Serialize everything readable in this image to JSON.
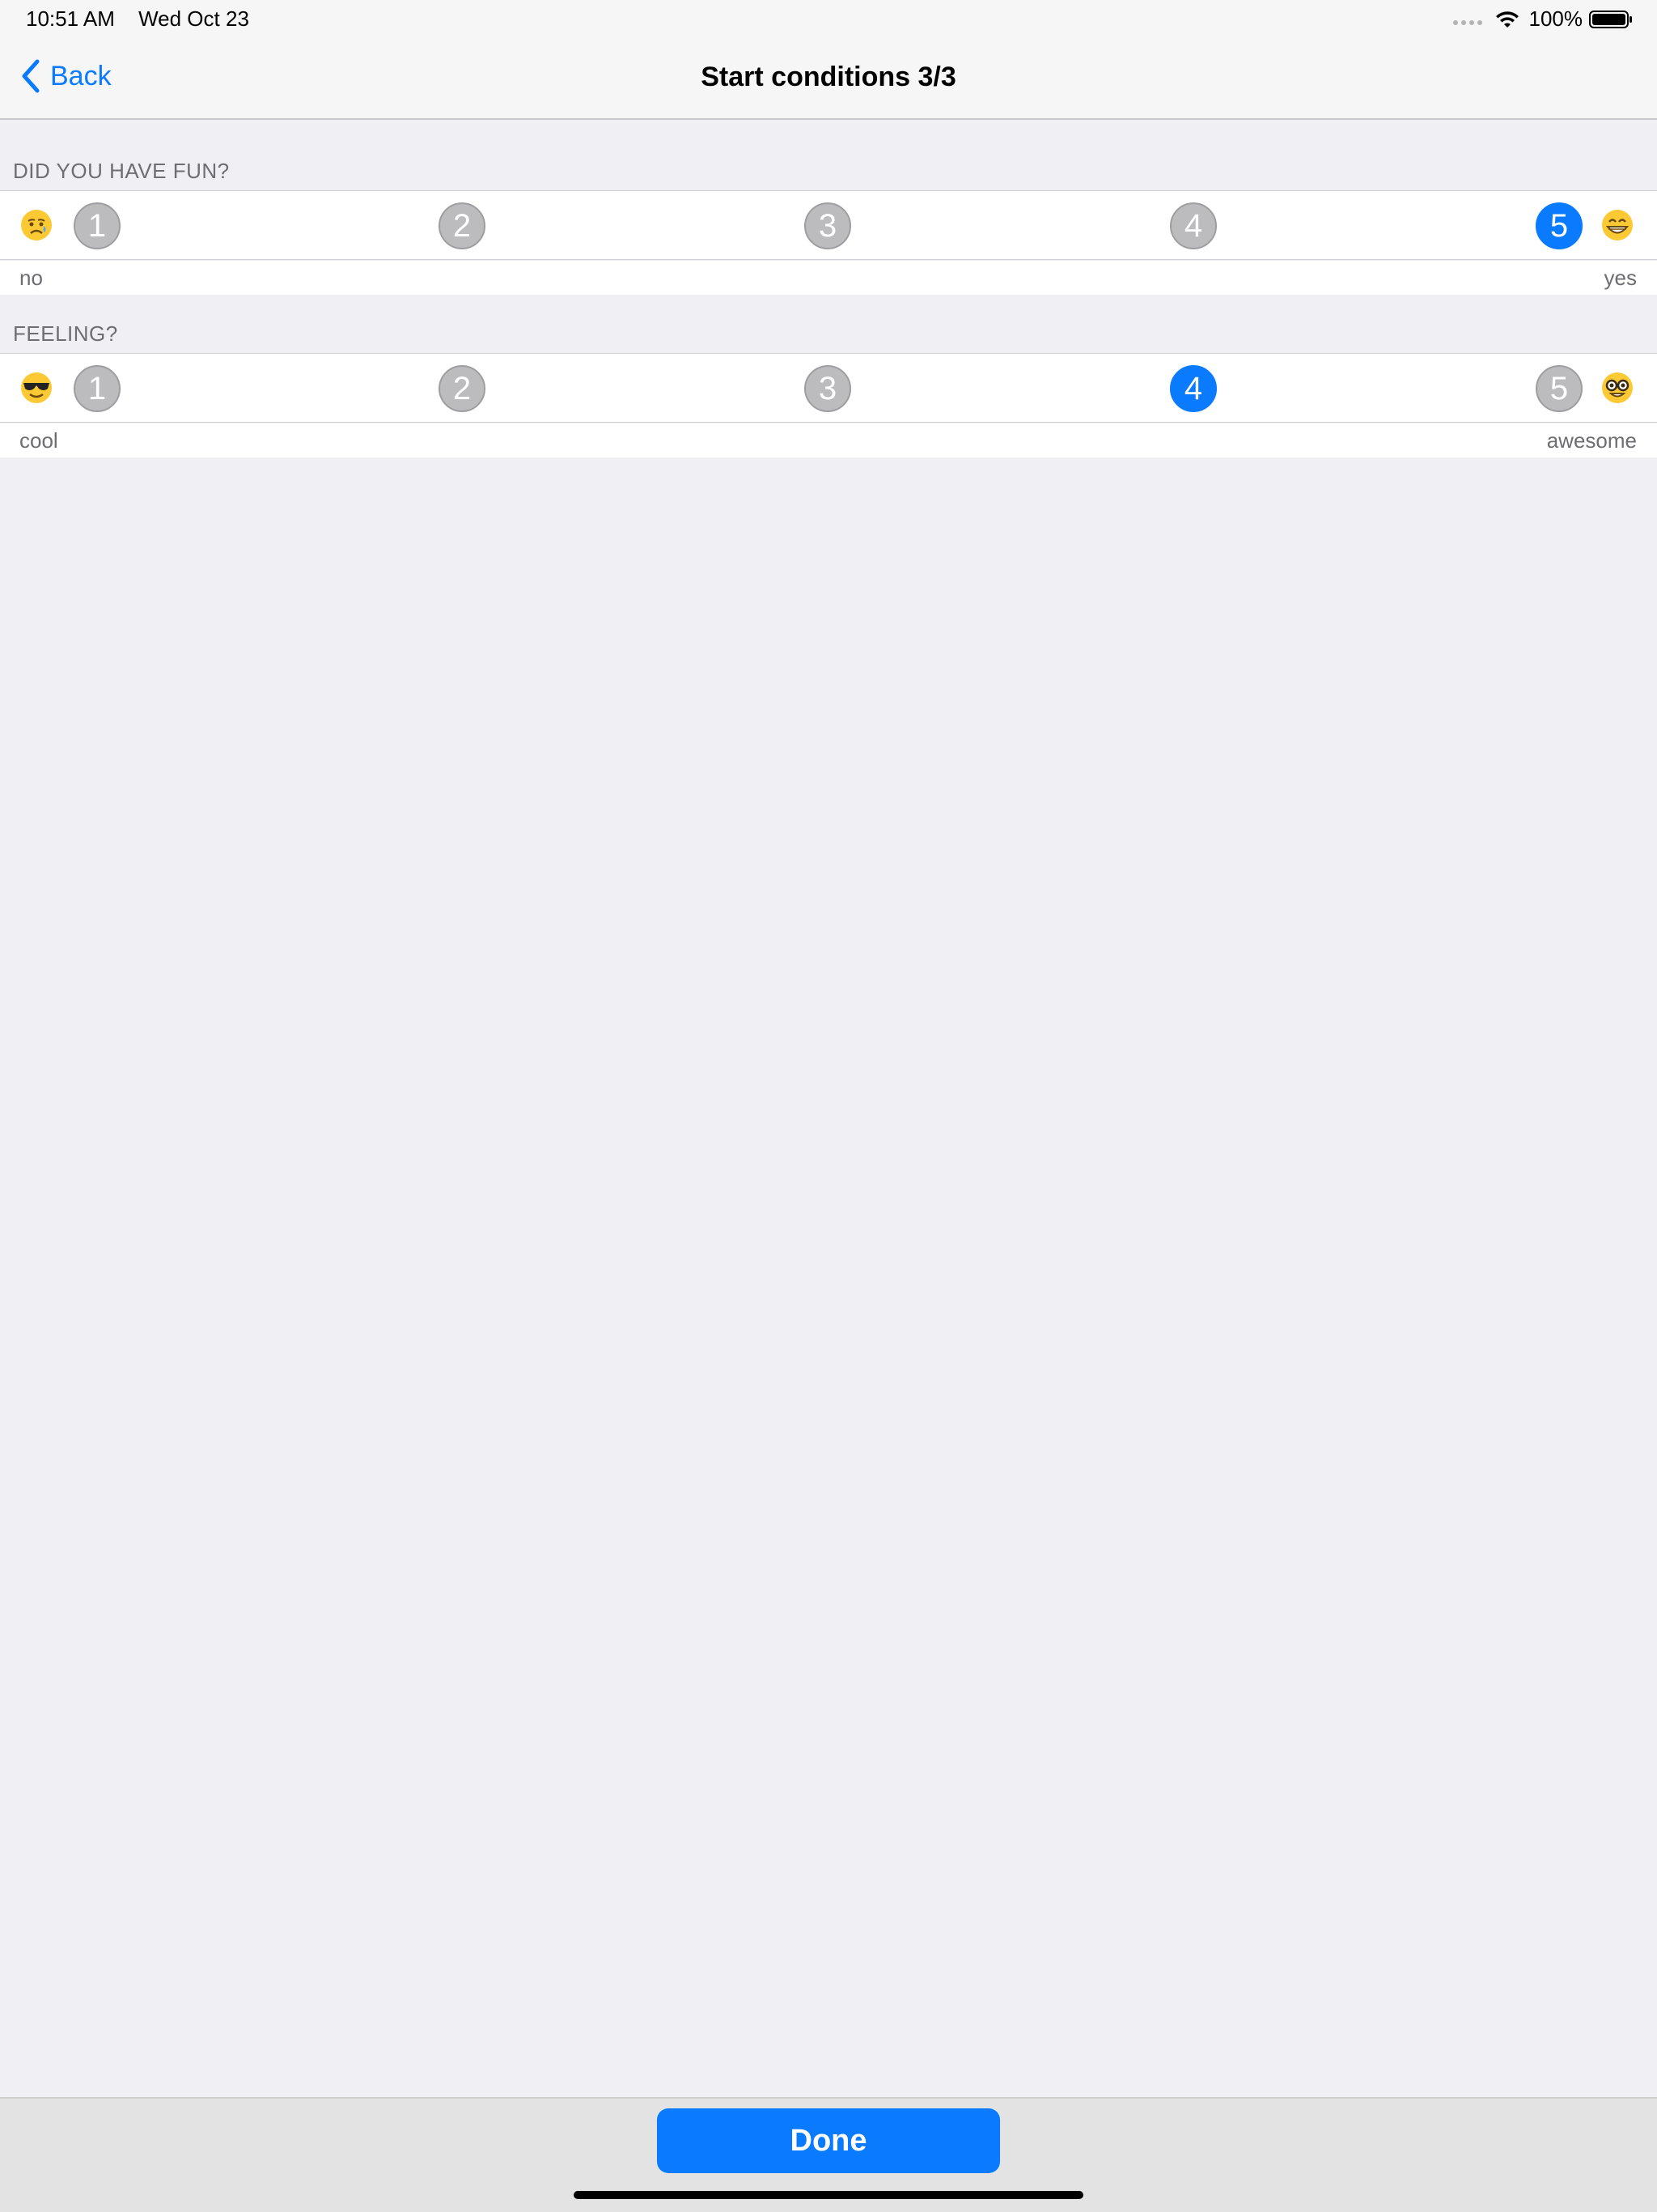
{
  "status_bar": {
    "time": "10:51 AM",
    "date": "Wed Oct 23",
    "battery": "100%",
    "icons": [
      "signal-dots-icon",
      "wifi-icon",
      "battery-icon"
    ]
  },
  "nav": {
    "back_label": "Back",
    "title": "Start conditions 3/3"
  },
  "questions": [
    {
      "header": "DID YOU HAVE FUN?",
      "options": [
        "1",
        "2",
        "3",
        "4",
        "5"
      ],
      "selected": "5",
      "min_label": "no",
      "max_label": "yes",
      "left_emoji": "sad-tear-face-icon",
      "right_emoji": "grinning-face-icon"
    },
    {
      "header": "FEELING?",
      "options": [
        "1",
        "2",
        "3",
        "4",
        "5"
      ],
      "selected": "4",
      "min_label": "cool",
      "max_label": "awesome",
      "left_emoji": "sunglasses-face-icon",
      "right_emoji": "nerd-face-icon"
    }
  ],
  "footer": {
    "done_label": "Done"
  },
  "colors": {
    "accent": "#0a7aff",
    "background": "#efeff4",
    "unselected": "#bcbcbe"
  }
}
